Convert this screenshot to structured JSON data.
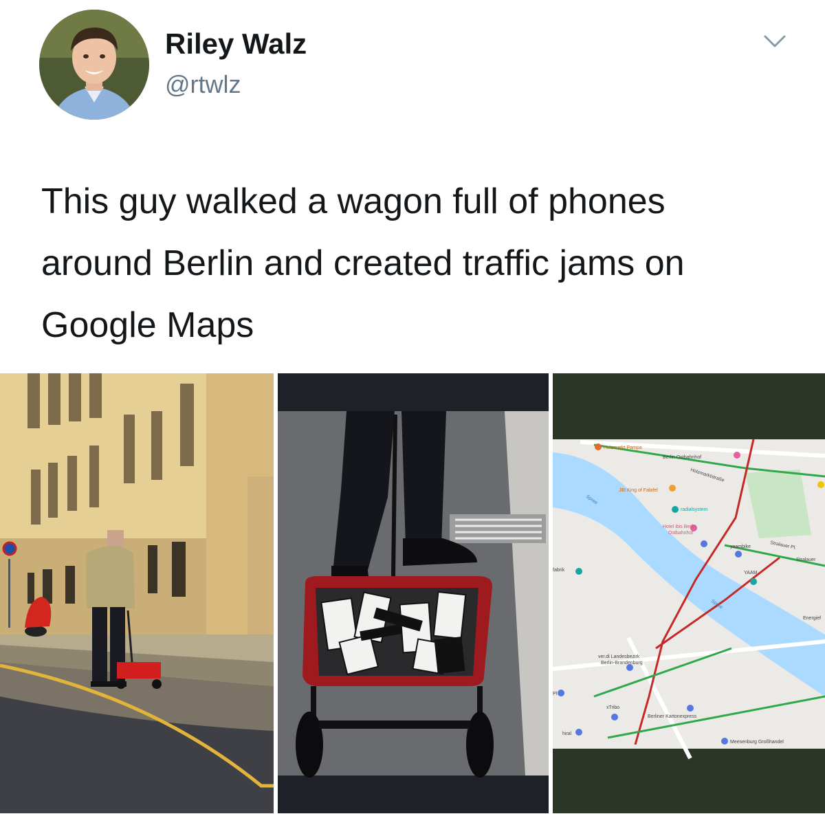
{
  "author": {
    "name": "Riley Walz",
    "handle": "@rtwlz"
  },
  "tweet": {
    "text": "This guy walked a wagon full of phones around Berlin and created traffic jams on Google Maps"
  },
  "media": [
    {
      "kind": "photo",
      "subject": "building-street"
    },
    {
      "kind": "photo",
      "subject": "wagon-of-phones"
    },
    {
      "kind": "map",
      "labels": {
        "holzmarkt": "Holzmarkt Pampa",
        "ostbahnhof": "Berlin Ostbahnhof",
        "holzmarktstr": "Holzmarktstraße",
        "jbi": "JBI King of Falafel",
        "spree1": "Spree",
        "radialsystem": "radialsystem",
        "hotel1": "Hotel ibis Berlin",
        "hotel2": "Ostbahnhof",
        "stralauerplatz": "Stralauer Pl.",
        "yaambike": "yaambike",
        "stralauer": "Stralauer",
        "yaam": "YAAM",
        "fabrik": "fabrik",
        "spree2": "Spree",
        "energie": "Energief",
        "verdi1": "ver.di Landesbezirk",
        "verdi2": "Berlin-Brandenburg",
        "xtribo": "xTribo",
        "kartonexpress": "Berliner Kartonexpress",
        "meesenburg": "Meesenburg Großhandel",
        "hiral": "hiral",
        "pl": "Pl"
      }
    }
  ],
  "colors": {
    "handle": "#657786",
    "text": "#14171a",
    "map_water": "#aadaff",
    "traffic_red": "#c62828",
    "traffic_green": "#2ea84a",
    "map_frame": "#2c3627"
  }
}
